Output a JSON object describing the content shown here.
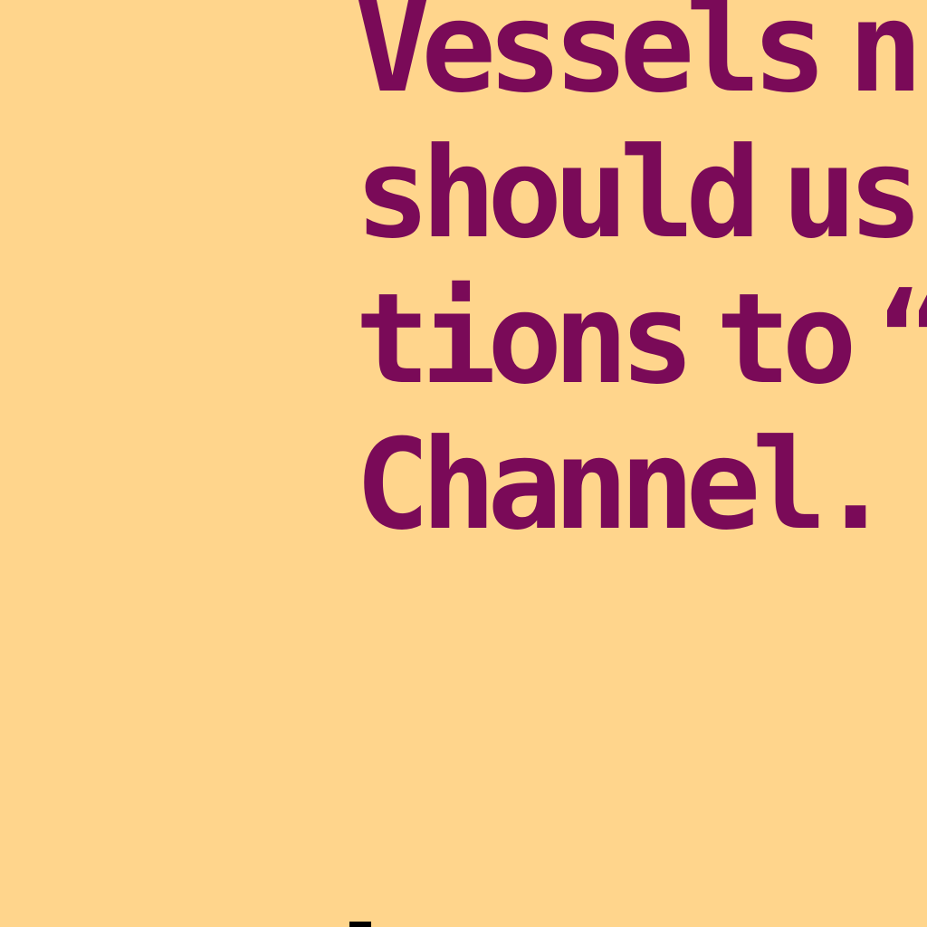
{
  "screen": {
    "background_color": "#FFD58C",
    "text_color": "#7A0A58",
    "cursor_color": "#000000"
  },
  "message": {
    "lines": [
      "Vessels n",
      "should us",
      "tions to “",
      "Channel."
    ]
  }
}
